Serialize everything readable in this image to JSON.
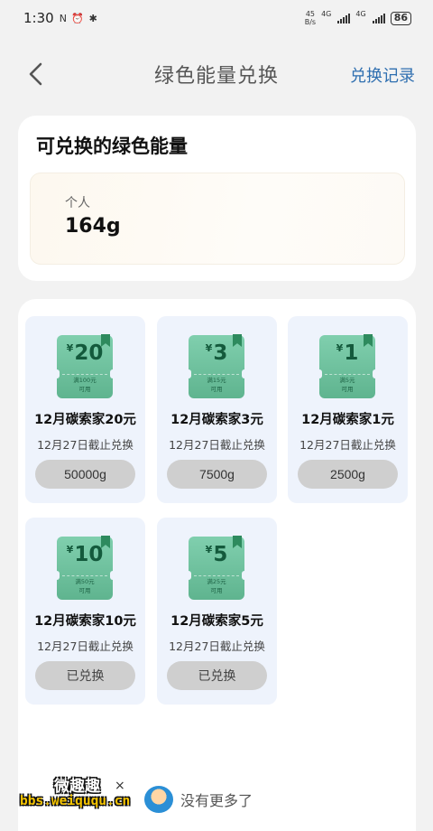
{
  "status_bar": {
    "time": "1:30",
    "indicators": "N ⏰ ✱",
    "speed_top": "45",
    "speed_bottom": "B/s",
    "net1": "4G",
    "net2": "4G",
    "battery": "86"
  },
  "header": {
    "back_icon": "chevron-left-icon",
    "title": "绿色能量兑换",
    "records_link": "兑换记录"
  },
  "energy": {
    "title": "可兑换的绿色能量",
    "label": "个人",
    "value": "164g"
  },
  "coupons": [
    {
      "yen": "¥",
      "amount": "20",
      "cond1": "满100元",
      "cond2": "可用",
      "name": "12月碳索家20元",
      "deadline": "12月27日截止兑换",
      "action": "50000g",
      "redeemed": false
    },
    {
      "yen": "¥",
      "amount": "3",
      "cond1": "满15元",
      "cond2": "可用",
      "name": "12月碳索家3元",
      "deadline": "12月27日截止兑换",
      "action": "7500g",
      "redeemed": false
    },
    {
      "yen": "¥",
      "amount": "1",
      "cond1": "满5元",
      "cond2": "可用",
      "name": "12月碳索家1元",
      "deadline": "12月27日截止兑换",
      "action": "2500g",
      "redeemed": false
    },
    {
      "yen": "¥",
      "amount": "10",
      "cond1": "满50元",
      "cond2": "可用",
      "name": "12月碳索家10元",
      "deadline": "12月27日截止兑换",
      "action": "已兑换",
      "redeemed": true
    },
    {
      "yen": "¥",
      "amount": "5",
      "cond1": "满25元",
      "cond2": "可用",
      "name": "12月碳索家5元",
      "deadline": "12月27日截止兑换",
      "action": "已兑换",
      "redeemed": true
    }
  ],
  "footer": {
    "no_more": "没有更多了",
    "mascot_icon": "mascot-icon"
  },
  "watermark": {
    "top": "微趣趣",
    "x": "×",
    "bottom": "bbs.weiququ.cn"
  },
  "colors": {
    "accent_link": "#2f6fb0",
    "ticket_green": "#6dbf9b",
    "card_bg": "#eef3fc",
    "button_gray": "#cfcfcf"
  }
}
